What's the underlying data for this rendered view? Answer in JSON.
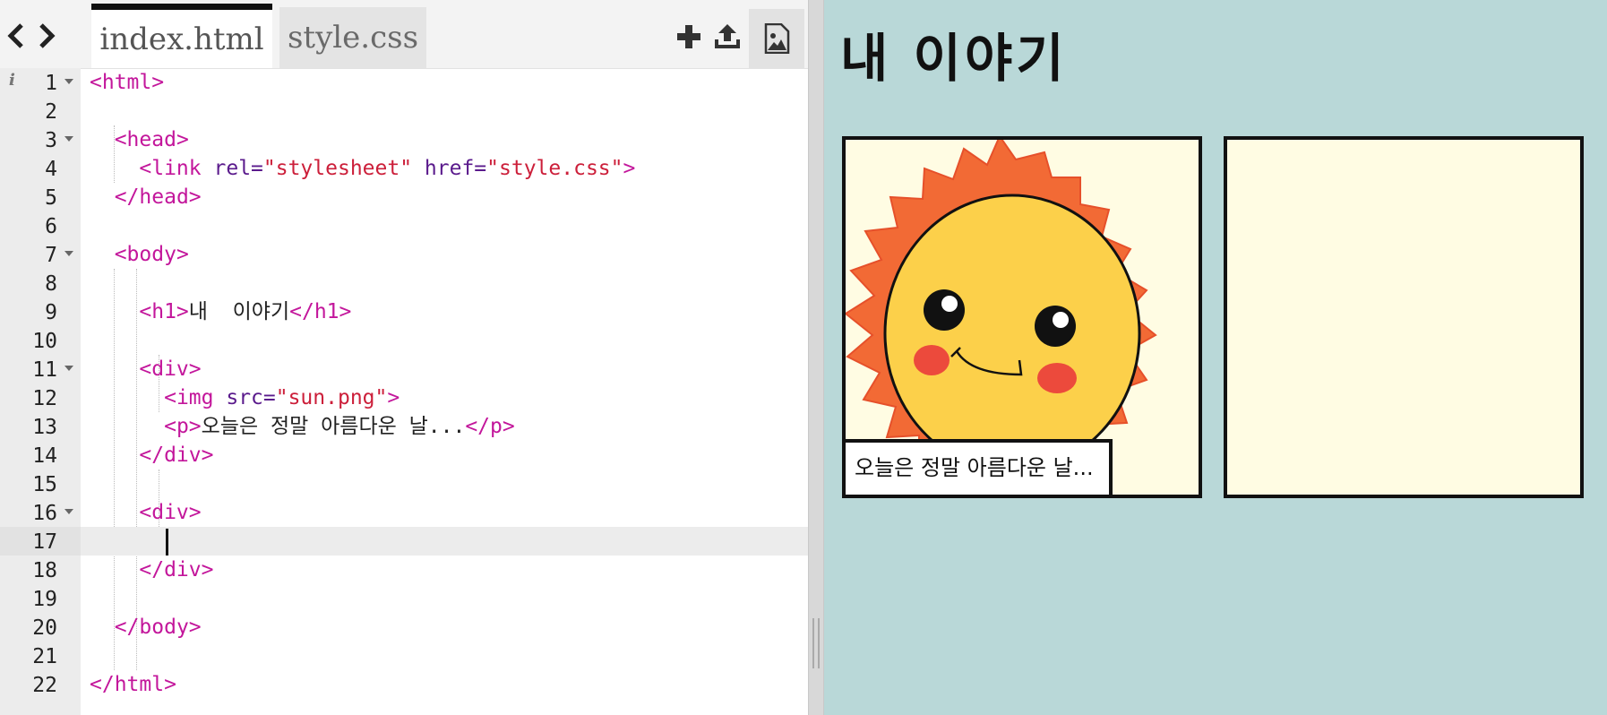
{
  "editor": {
    "nav": {
      "back_glyph": "‹",
      "forward_glyph": "›"
    },
    "tabs": [
      {
        "label": "index.html",
        "active": true
      },
      {
        "label": "style.css",
        "active": false
      }
    ],
    "tools": [
      "plus-icon",
      "upload-icon",
      "image-icon"
    ],
    "current_line": 17,
    "lines": [
      {
        "n": "1",
        "fold": true
      },
      {
        "n": "2"
      },
      {
        "n": "3",
        "fold": true
      },
      {
        "n": "4"
      },
      {
        "n": "5"
      },
      {
        "n": "6"
      },
      {
        "n": "7",
        "fold": true
      },
      {
        "n": "8"
      },
      {
        "n": "9"
      },
      {
        "n": "10"
      },
      {
        "n": "11",
        "fold": true
      },
      {
        "n": "12"
      },
      {
        "n": "13"
      },
      {
        "n": "14"
      },
      {
        "n": "15"
      },
      {
        "n": "16",
        "fold": true
      },
      {
        "n": "17"
      },
      {
        "n": "18"
      },
      {
        "n": "19"
      },
      {
        "n": "20"
      },
      {
        "n": "21"
      },
      {
        "n": "22"
      }
    ],
    "code": {
      "l1": "<html>",
      "l3": "<head>",
      "l4_tag_open": "<link",
      "l4_attr1": "rel=",
      "l4_val1": "\"stylesheet\"",
      "l4_attr2": "href=",
      "l4_val2": "\"style.css\"",
      "l4_close": ">",
      "l5": "</head>",
      "l7": "<body>",
      "l9_open": "<h1>",
      "l9_text": "내  이야기",
      "l9_close": "</h1>",
      "l11": "<div>",
      "l12_open": "<img",
      "l12_attr": "src=",
      "l12_val": "\"sun.png\"",
      "l12_close": ">",
      "l13_open": "<p>",
      "l13_text": "오늘은 정말 아름다운 날...",
      "l13_close": "</p>",
      "l14": "</div>",
      "l16": "<div>",
      "l18": "</div>",
      "l20": "</body>",
      "l22": "</html>"
    }
  },
  "preview": {
    "title": "내 이야기",
    "panels": [
      {
        "image": "sun-illustration",
        "caption": "오늘은 정말 아름다운 날..."
      },
      {
        "image": null,
        "caption": null
      }
    ],
    "colors": {
      "background": "#b9d8d8",
      "panel": "#fffce3",
      "sun_rays": "#f26a35",
      "sun_face": "#fcd04a",
      "cheeks": "#ec4a3c"
    }
  }
}
